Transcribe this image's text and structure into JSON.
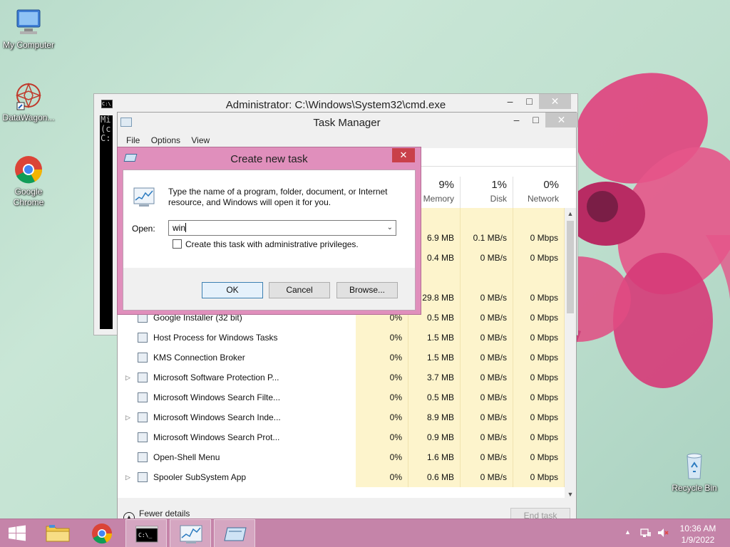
{
  "desktop": {
    "icons": [
      {
        "label": "My Computer"
      },
      {
        "label": "DataWagon..."
      },
      {
        "label": "Google Chrome"
      },
      {
        "label": "Recycle Bin"
      }
    ]
  },
  "cmd_window": {
    "title": "Administrator: C:\\Windows\\System32\\cmd.exe",
    "console_lines": [
      "Mi",
      "(c",
      "",
      "C:"
    ]
  },
  "task_manager": {
    "title": "Task Manager",
    "menu": [
      "File",
      "Options",
      "View"
    ],
    "columns": [
      {
        "pct": "9%",
        "label": "Memory"
      },
      {
        "pct": "1%",
        "label": "Disk"
      },
      {
        "pct": "0%",
        "label": "Network"
      }
    ],
    "rows": [
      {
        "name": "",
        "cpu": "",
        "mem": "",
        "disk": "",
        "net": ""
      },
      {
        "name": "",
        "cpu": "",
        "mem": "6.9 MB",
        "disk": "0.1 MB/s",
        "net": "0 Mbps"
      },
      {
        "name": "",
        "cpu": "",
        "mem": "0.4 MB",
        "disk": "0 MB/s",
        "net": "0 Mbps"
      },
      {
        "name": "",
        "cpu": "",
        "mem": "",
        "disk": "",
        "net": ""
      },
      {
        "name": "",
        "cpu": "",
        "mem": "29.8 MB",
        "disk": "0 MB/s",
        "net": "0 Mbps"
      },
      {
        "name": "Google Installer (32 bit)",
        "cpu": "0%",
        "mem": "0.5 MB",
        "disk": "0 MB/s",
        "net": "0 Mbps",
        "expand": false
      },
      {
        "name": "Host Process for Windows Tasks",
        "cpu": "0%",
        "mem": "1.5 MB",
        "disk": "0 MB/s",
        "net": "0 Mbps",
        "expand": false
      },
      {
        "name": "KMS Connection Broker",
        "cpu": "0%",
        "mem": "1.5 MB",
        "disk": "0 MB/s",
        "net": "0 Mbps",
        "expand": false
      },
      {
        "name": "Microsoft Software Protection P...",
        "cpu": "0%",
        "mem": "3.7 MB",
        "disk": "0 MB/s",
        "net": "0 Mbps",
        "expand": true
      },
      {
        "name": "Microsoft Windows Search Filte...",
        "cpu": "0%",
        "mem": "0.5 MB",
        "disk": "0 MB/s",
        "net": "0 Mbps",
        "expand": false
      },
      {
        "name": "Microsoft Windows Search Inde...",
        "cpu": "0%",
        "mem": "8.9 MB",
        "disk": "0 MB/s",
        "net": "0 Mbps",
        "expand": true
      },
      {
        "name": "Microsoft Windows Search Prot...",
        "cpu": "0%",
        "mem": "0.9 MB",
        "disk": "0 MB/s",
        "net": "0 Mbps",
        "expand": false
      },
      {
        "name": "Open-Shell Menu",
        "cpu": "0%",
        "mem": "1.6 MB",
        "disk": "0 MB/s",
        "net": "0 Mbps",
        "expand": false
      },
      {
        "name": "Spooler SubSystem App",
        "cpu": "0%",
        "mem": "0.6 MB",
        "disk": "0 MB/s",
        "net": "0 Mbps",
        "expand": true
      }
    ],
    "fewer_details": "Fewer details",
    "end_task": "End task"
  },
  "dialog": {
    "title": "Create new task",
    "message": "Type the name of a program, folder, document, or Internet resource, and Windows will open it for you.",
    "open_label": "Open:",
    "open_value": "win",
    "admin_checkbox": "Create this task with administrative privileges.",
    "ok": "OK",
    "cancel": "Cancel",
    "browse": "Browse..."
  },
  "taskbar": {
    "time": "10:36 AM",
    "date": "1/9/2022"
  },
  "colors": {
    "accent": "#c584a9",
    "dialog_frame": "#e08fbc",
    "highlight_column": "#fdf4cc"
  }
}
